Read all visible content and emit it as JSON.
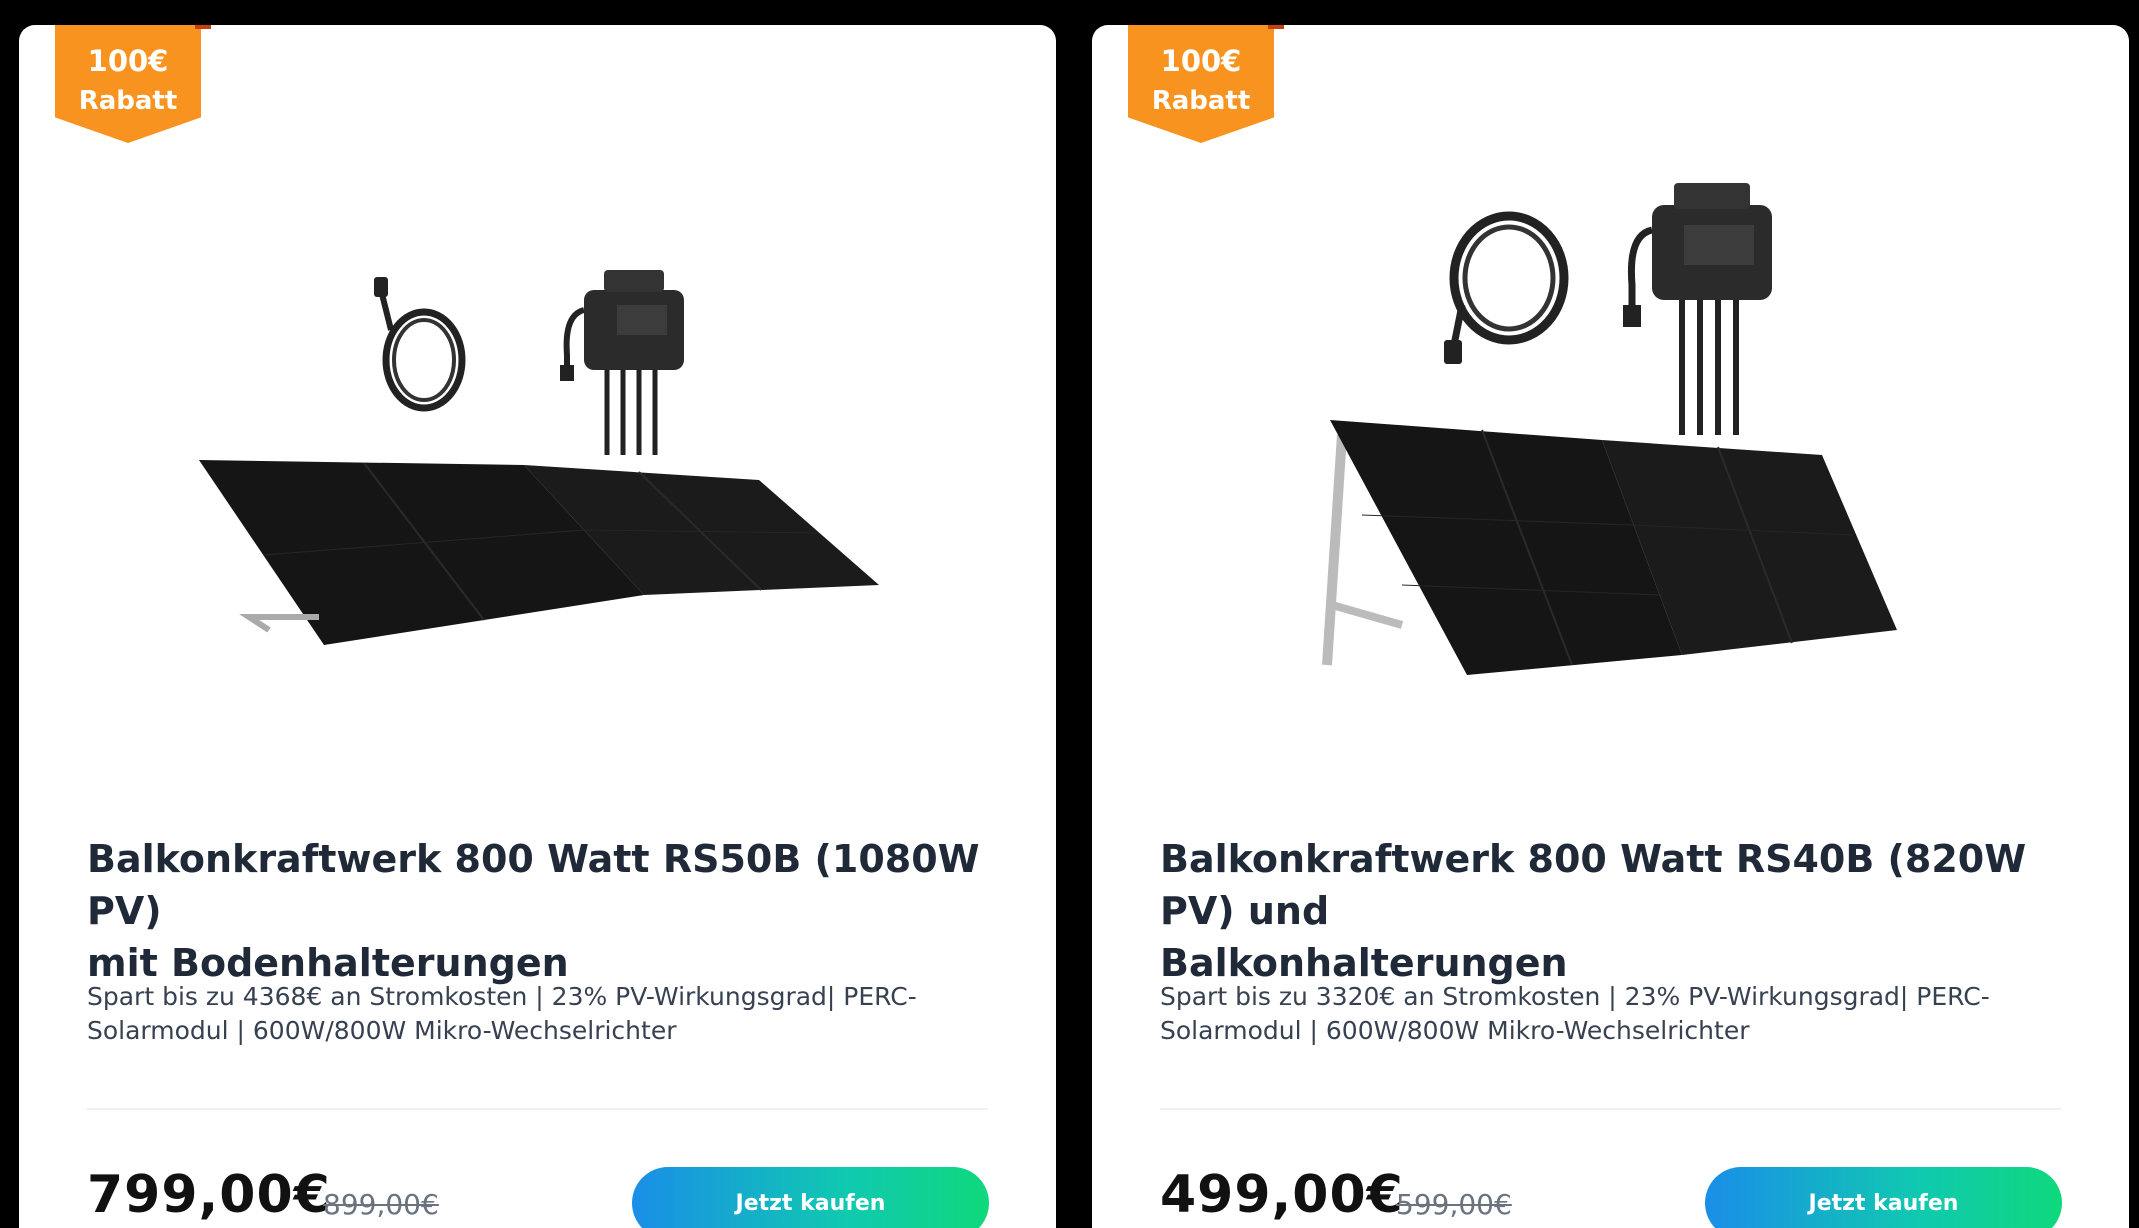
{
  "products": [
    {
      "badge": {
        "amount": "100€",
        "label": "Rabatt"
      },
      "title_line1": "Balkonkraftwerk 800 Watt RS50B (1080W PV)",
      "title_line2": "mit Bodenhalterungen",
      "description_line1": "Spart bis zu 4368€ an Stromkosten | 23% PV-Wirkungsgrad| PERC-",
      "description_line2": "Solarmodul | 600W/800W Mikro-Wechselrichter",
      "price": "799,00€",
      "old_price": "899,00€",
      "button_label": "Jetzt kaufen"
    },
    {
      "badge": {
        "amount": "100€",
        "label": "Rabatt"
      },
      "title_line1": "Balkonkraftwerk 800 Watt RS40B (820W PV) und",
      "title_line2": "Balkonhalterungen",
      "description_line1": "Spart bis zu 3320€ an Stromkosten | 23% PV-Wirkungsgrad| PERC-",
      "description_line2": "Solarmodul | 600W/800W Mikro-Wechselrichter",
      "price": "499,00€",
      "old_price": "599,00€",
      "button_label": "Jetzt kaufen"
    }
  ],
  "colors": {
    "badge": "#f7931e",
    "button_gradient_start": "#1a8ee8",
    "button_gradient_end": "#0fd87c"
  }
}
